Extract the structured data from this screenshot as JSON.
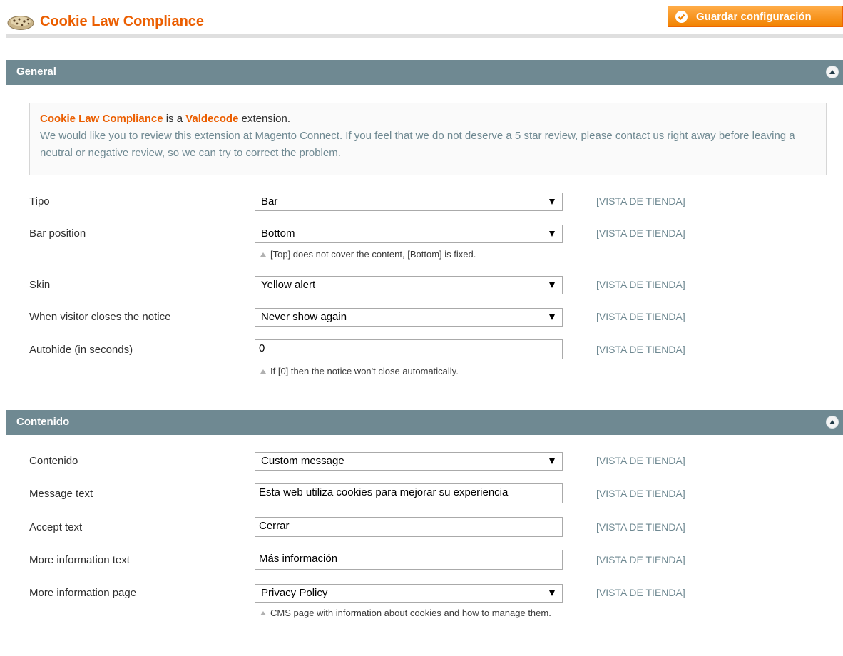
{
  "header": {
    "title": "Cookie Law Compliance",
    "save_label": "Guardar configuración"
  },
  "icons": {
    "page": "cookie-icon",
    "save": "check-circle-icon",
    "collapse": "chevron-up-circle-icon",
    "note": "triangle-up-icon",
    "select_arrow": "caret-down-icon"
  },
  "colors": {
    "brand_orange": "#eb5e00",
    "section_header": "#6f8992",
    "scope_text": "#6f8992"
  },
  "general": {
    "title": "General",
    "notice": {
      "product_link": "Cookie Law Compliance",
      "text_is_a": " is a ",
      "vendor_link": "Valdecode",
      "text_extension": " extension.",
      "review_text": "We would like you to review this extension at Magento Connect. If you feel that we do not deserve a 5 star review, please contact us right away before leaving a neutral or negative review, so we can try to correct the problem."
    },
    "fields": [
      {
        "label": "Tipo",
        "value": "Bar",
        "scope": "[VISTA DE TIENDA]"
      },
      {
        "label": "Bar position",
        "value": "Bottom",
        "scope": "[VISTA DE TIENDA]",
        "note": "[Top] does not cover the content, [Bottom] is fixed."
      },
      {
        "label": "Skin",
        "value": "Yellow alert",
        "scope": "[VISTA DE TIENDA]"
      },
      {
        "label": "When visitor closes the notice",
        "value": "Never show again",
        "scope": "[VISTA DE TIENDA]"
      },
      {
        "label": "Autohide (in seconds)",
        "value": "0",
        "scope": "[VISTA DE TIENDA]",
        "note": "If [0] then the notice won't close automatically."
      }
    ]
  },
  "contenido": {
    "title": "Contenido",
    "fields": [
      {
        "label": "Contenido",
        "value": "Custom message",
        "scope": "[VISTA DE TIENDA]"
      },
      {
        "label": "Message text",
        "value": "Esta web utiliza cookies para mejorar su experiencia",
        "scope": "[VISTA DE TIENDA]"
      },
      {
        "label": "Accept text",
        "value": "Cerrar",
        "scope": "[VISTA DE TIENDA]"
      },
      {
        "label": "More information text",
        "value": "Más información",
        "scope": "[VISTA DE TIENDA]"
      },
      {
        "label": "More information page",
        "value": "Privacy Policy",
        "scope": "[VISTA DE TIENDA]",
        "note": "CMS page with information about cookies and how to manage them."
      }
    ]
  }
}
